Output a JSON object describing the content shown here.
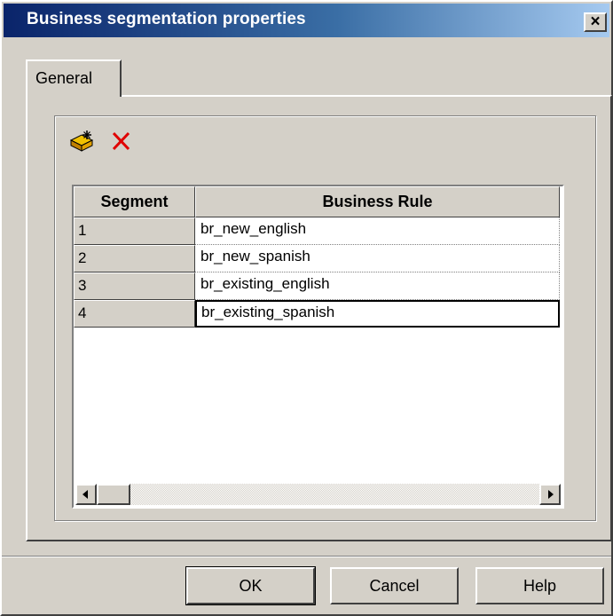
{
  "window": {
    "title": "Business segmentation properties",
    "close_glyph": "✕"
  },
  "tabs": [
    {
      "label": "General",
      "active": true
    }
  ],
  "toolbar": {
    "new_icon": "new-row-icon",
    "delete_icon": "delete-icon",
    "delete_color": "#e00000"
  },
  "grid": {
    "columns": [
      "Segment",
      "Business Rule"
    ],
    "rows": [
      {
        "segment": "1",
        "rule": "br_new_english"
      },
      {
        "segment": "2",
        "rule": "br_new_spanish"
      },
      {
        "segment": "3",
        "rule": "br_existing_english"
      },
      {
        "segment": "4",
        "rule": "br_existing_spanish"
      }
    ],
    "selected_row": 4
  },
  "buttons": {
    "ok": "OK",
    "cancel": "Cancel",
    "help": "Help"
  },
  "colors": {
    "title_start": "#0a246a",
    "title_end": "#a6caf0",
    "face": "#d4d0c8"
  }
}
